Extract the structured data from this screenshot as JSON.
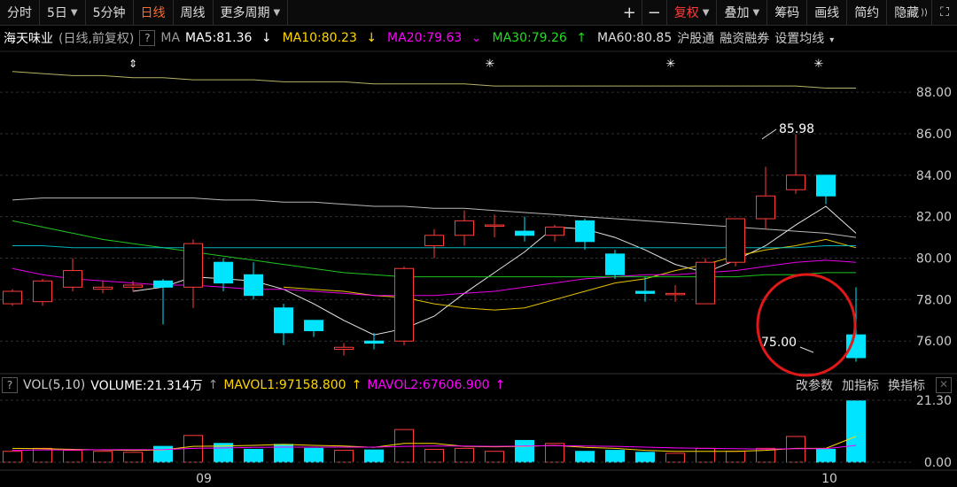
{
  "toolbar": {
    "items": [
      "分时",
      "5日",
      "5分钟",
      "日线",
      "周线",
      "更多周期"
    ],
    "active": "日线",
    "right_items": [
      "复权",
      "叠加",
      "筹码",
      "画线",
      "简约",
      "隐藏"
    ],
    "plus": "+",
    "minus": "−"
  },
  "legend": {
    "stock_name": "海天味业",
    "mode": "(日线,前复权)",
    "q": "?",
    "ma_label": "MA",
    "ma5": "MA5:81.36",
    "ma10": "MA10:80.23",
    "ma20": "MA20:79.63",
    "ma30": "MA30:79.26",
    "ma60": "MA60:80.85",
    "tags": [
      "沪股通",
      "融资融券",
      "设置均线"
    ]
  },
  "price_axis": {
    "ticks": [
      "88.00",
      "86.00",
      "84.00",
      "82.00",
      "80.00",
      "78.00",
      "76.00"
    ]
  },
  "annotations": {
    "high": "85.98",
    "low": "75.00"
  },
  "volume": {
    "label": "VOL(5,10)",
    "volume": "VOLUME:21.314万",
    "mavol1": "MAVOL1:97158.800",
    "mavol2": "MAVOL2:67606.900",
    "buttons": [
      "改参数",
      "加指标",
      "换指标"
    ],
    "axis_ticks": [
      "21.30",
      "0.00"
    ]
  },
  "x_axis": {
    "labels": [
      "09",
      "10"
    ]
  },
  "colors": {
    "up": "#ff3b3b",
    "down": "#00e4ff",
    "ma5": "#ffffff",
    "ma10": "#ffd700",
    "ma20": "#ff00ff",
    "ma30": "#22dd22",
    "ma60": "#cccccc",
    "active": "#ff6a2a"
  },
  "chart_data": {
    "type": "candlestick",
    "ylim": [
      74.6,
      89.8
    ],
    "candles": [
      {
        "o": 77.8,
        "c": 78.4,
        "h": 78.5,
        "l": 77.7
      },
      {
        "o": 77.9,
        "c": 78.9,
        "h": 79.0,
        "l": 77.7
      },
      {
        "o": 78.6,
        "c": 79.4,
        "h": 80.0,
        "l": 78.4
      },
      {
        "o": 78.5,
        "c": 78.6,
        "h": 78.9,
        "l": 78.3
      },
      {
        "o": 78.6,
        "c": 78.7,
        "h": 78.9,
        "l": 78.4
      },
      {
        "o": 78.9,
        "c": 78.6,
        "h": 79.0,
        "l": 76.8
      },
      {
        "o": 78.6,
        "c": 80.7,
        "h": 80.9,
        "l": 77.6
      },
      {
        "o": 79.8,
        "c": 78.8,
        "h": 80.0,
        "l": 78.4
      },
      {
        "o": 79.2,
        "c": 78.2,
        "h": 79.8,
        "l": 78.0
      },
      {
        "o": 77.6,
        "c": 76.4,
        "h": 77.8,
        "l": 75.8
      },
      {
        "o": 77.0,
        "c": 76.5,
        "h": 77.0,
        "l": 76.2
      },
      {
        "o": 75.6,
        "c": 75.7,
        "h": 75.9,
        "l": 75.3
      },
      {
        "o": 76.0,
        "c": 75.9,
        "h": 76.4,
        "l": 75.6
      },
      {
        "o": 76.0,
        "c": 79.5,
        "h": 79.6,
        "l": 75.8
      },
      {
        "o": 80.6,
        "c": 81.1,
        "h": 81.4,
        "l": 80.0
      },
      {
        "o": 81.1,
        "c": 81.8,
        "h": 82.3,
        "l": 80.6
      },
      {
        "o": 81.6,
        "c": 81.6,
        "h": 82.1,
        "l": 81.0
      },
      {
        "o": 81.3,
        "c": 81.1,
        "h": 82.0,
        "l": 80.8
      },
      {
        "o": 81.1,
        "c": 81.5,
        "h": 81.6,
        "l": 80.8
      },
      {
        "o": 81.8,
        "c": 80.8,
        "h": 81.9,
        "l": 80.4
      },
      {
        "o": 80.2,
        "c": 79.2,
        "h": 80.4,
        "l": 79.0
      },
      {
        "o": 78.4,
        "c": 78.3,
        "h": 79.1,
        "l": 77.9
      },
      {
        "o": 78.3,
        "c": 78.3,
        "h": 78.7,
        "l": 77.9
      },
      {
        "o": 77.8,
        "c": 79.8,
        "h": 80.0,
        "l": 77.8
      },
      {
        "o": 79.8,
        "c": 81.9,
        "h": 81.9,
        "l": 79.6
      },
      {
        "o": 81.9,
        "c": 83.0,
        "h": 84.4,
        "l": 81.4
      },
      {
        "o": 83.3,
        "c": 84.0,
        "h": 85.98,
        "l": 83.1
      },
      {
        "o": 84.0,
        "c": 83.0,
        "h": 84.0,
        "l": 82.6
      },
      {
        "o": 76.3,
        "c": 75.2,
        "h": 78.6,
        "l": 75.0
      }
    ],
    "volumes": [
      0.55,
      0.7,
      0.6,
      0.55,
      0.5,
      0.8,
      1.35,
      0.95,
      0.65,
      0.9,
      0.7,
      0.6,
      0.62,
      1.65,
      0.65,
      0.7,
      0.55,
      1.1,
      0.95,
      0.55,
      0.6,
      0.5,
      0.45,
      0.7,
      0.55,
      0.7,
      1.3,
      0.65,
      3.1
    ],
    "vol_ylim": [
      0,
      3.4
    ],
    "ma_lines": [
      {
        "name": "MA5",
        "color": "#ffffff",
        "values": [
          null,
          null,
          null,
          null,
          78.4,
          78.6,
          79.1,
          79.0,
          78.9,
          78.5,
          77.8,
          77.0,
          76.3,
          76.6,
          77.2,
          78.3,
          79.3,
          80.3,
          81.5,
          81.4,
          81.0,
          80.4,
          79.7,
          79.3,
          79.9,
          80.6,
          81.6,
          82.5,
          81.2
        ]
      },
      {
        "name": "MA10",
        "color": "#ffd700",
        "values": [
          null,
          null,
          null,
          null,
          null,
          null,
          null,
          null,
          null,
          78.6,
          78.5,
          78.4,
          78.2,
          78.1,
          77.8,
          77.6,
          77.5,
          77.6,
          78.0,
          78.4,
          78.8,
          79.0,
          79.4,
          79.7,
          80.1,
          80.4,
          80.6,
          80.9,
          80.5
        ]
      },
      {
        "name": "MA20",
        "color": "#ff00ff",
        "values": [
          79.5,
          79.2,
          79.0,
          78.9,
          78.8,
          78.7,
          78.7,
          78.6,
          78.5,
          78.5,
          78.4,
          78.3,
          78.2,
          78.2,
          78.2,
          78.3,
          78.4,
          78.6,
          78.8,
          79.0,
          79.1,
          79.2,
          79.2,
          79.3,
          79.4,
          79.6,
          79.8,
          79.9,
          79.8
        ]
      },
      {
        "name": "MA30",
        "color": "#22dd22",
        "values": [
          81.8,
          81.5,
          81.2,
          80.9,
          80.7,
          80.5,
          80.3,
          80.1,
          79.9,
          79.7,
          79.5,
          79.3,
          79.2,
          79.1,
          79.1,
          79.1,
          79.1,
          79.1,
          79.1,
          79.1,
          79.1,
          79.1,
          79.1,
          79.1,
          79.1,
          79.2,
          79.2,
          79.3,
          79.3
        ]
      },
      {
        "name": "MA60",
        "color": "#cccccc",
        "values": [
          82.8,
          82.9,
          82.9,
          82.9,
          82.9,
          82.9,
          82.9,
          82.8,
          82.8,
          82.7,
          82.7,
          82.6,
          82.5,
          82.5,
          82.4,
          82.4,
          82.3,
          82.2,
          82.1,
          82.0,
          81.9,
          81.8,
          81.7,
          81.6,
          81.5,
          81.4,
          81.3,
          81.2,
          81.0
        ]
      },
      {
        "name": "",
        "color": "#00c8d0",
        "values": [
          80.6,
          80.6,
          80.5,
          80.5,
          80.5,
          80.5,
          80.5,
          80.5,
          80.5,
          80.5,
          80.5,
          80.5,
          80.5,
          80.5,
          80.5,
          80.5,
          80.5,
          80.5,
          80.5,
          80.5,
          80.5,
          80.5,
          80.5,
          80.5,
          80.5,
          80.5,
          80.5,
          80.6,
          80.6
        ]
      },
      {
        "name": "",
        "color": "#c8c870",
        "values": [
          89.0,
          88.9,
          88.8,
          88.8,
          88.7,
          88.7,
          88.6,
          88.6,
          88.6,
          88.5,
          88.5,
          88.5,
          88.4,
          88.4,
          88.4,
          88.4,
          88.3,
          88.3,
          88.3,
          88.3,
          88.3,
          88.3,
          88.3,
          88.3,
          88.3,
          88.3,
          88.3,
          88.2,
          88.2
        ]
      }
    ]
  }
}
